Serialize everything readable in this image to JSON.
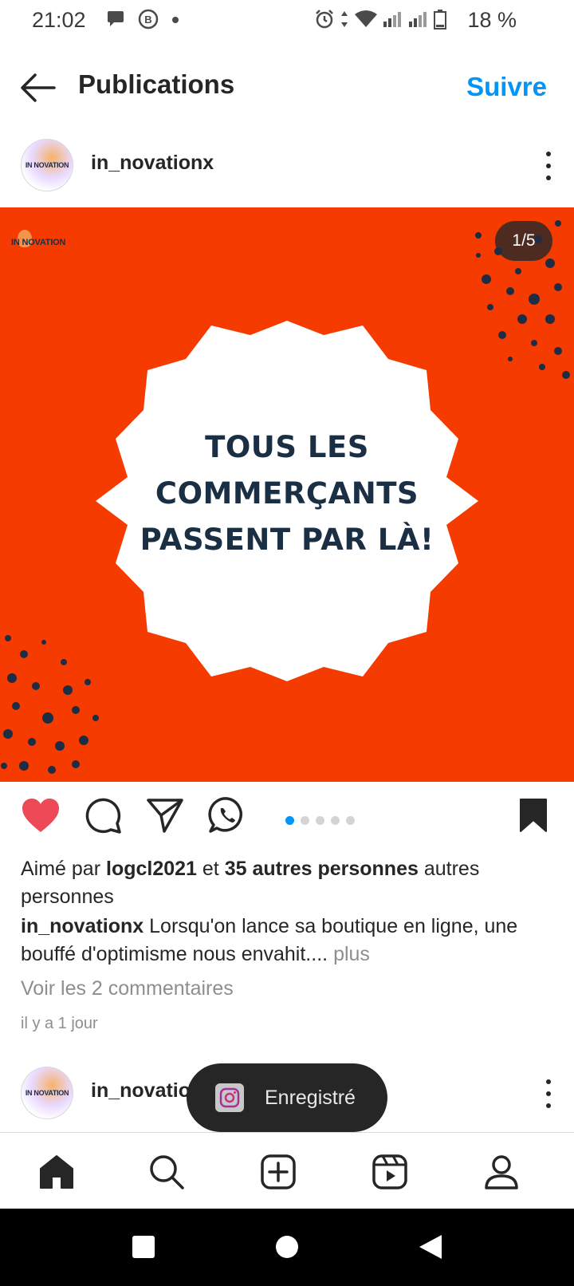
{
  "status_bar": {
    "time": "21:02",
    "battery": "18 %",
    "icons": [
      "chat-notification-icon",
      "b-notification-icon",
      "dot-icon",
      "alarm-icon",
      "data-arrows-icon",
      "wifi-icon",
      "signal-icon",
      "signal-icon-2",
      "battery-icon"
    ]
  },
  "header": {
    "title": "Publications",
    "follow_label": "Suivre"
  },
  "post": {
    "username": "in_novationx",
    "avatar_text": "IN NOVATION",
    "image": {
      "brand_text": "IN NOVATION",
      "counter": "1/5",
      "headline": [
        "TOUS LES",
        "COMMERÇANTS",
        "PASSENT PAR LÀ!"
      ],
      "background_color": "#f53b00",
      "headline_color": "#1a2e44"
    },
    "carousel": {
      "total": 5,
      "active": 1
    },
    "likes": {
      "prefix": "Aimé par",
      "user": "logcl2021",
      "middle": "et",
      "count_text": "35 autres personnes",
      "suffix": "autres personnes"
    },
    "caption": {
      "username": "in_novationx",
      "text": "Lorsqu'on lance sa boutique en ligne, une bouffé d'optimisme nous envahit....",
      "more": "plus"
    },
    "comments_link": "Voir les 2 commentaires",
    "timestamp": "il y a 1 jour"
  },
  "next_post": {
    "username": "in_novationx",
    "avatar_text": "IN NOVATION"
  },
  "toast": {
    "text": "Enregistré"
  },
  "colors": {
    "accent": "#0095f6",
    "like": "#ed4956",
    "text": "#262626",
    "muted": "#8e8e8e"
  }
}
